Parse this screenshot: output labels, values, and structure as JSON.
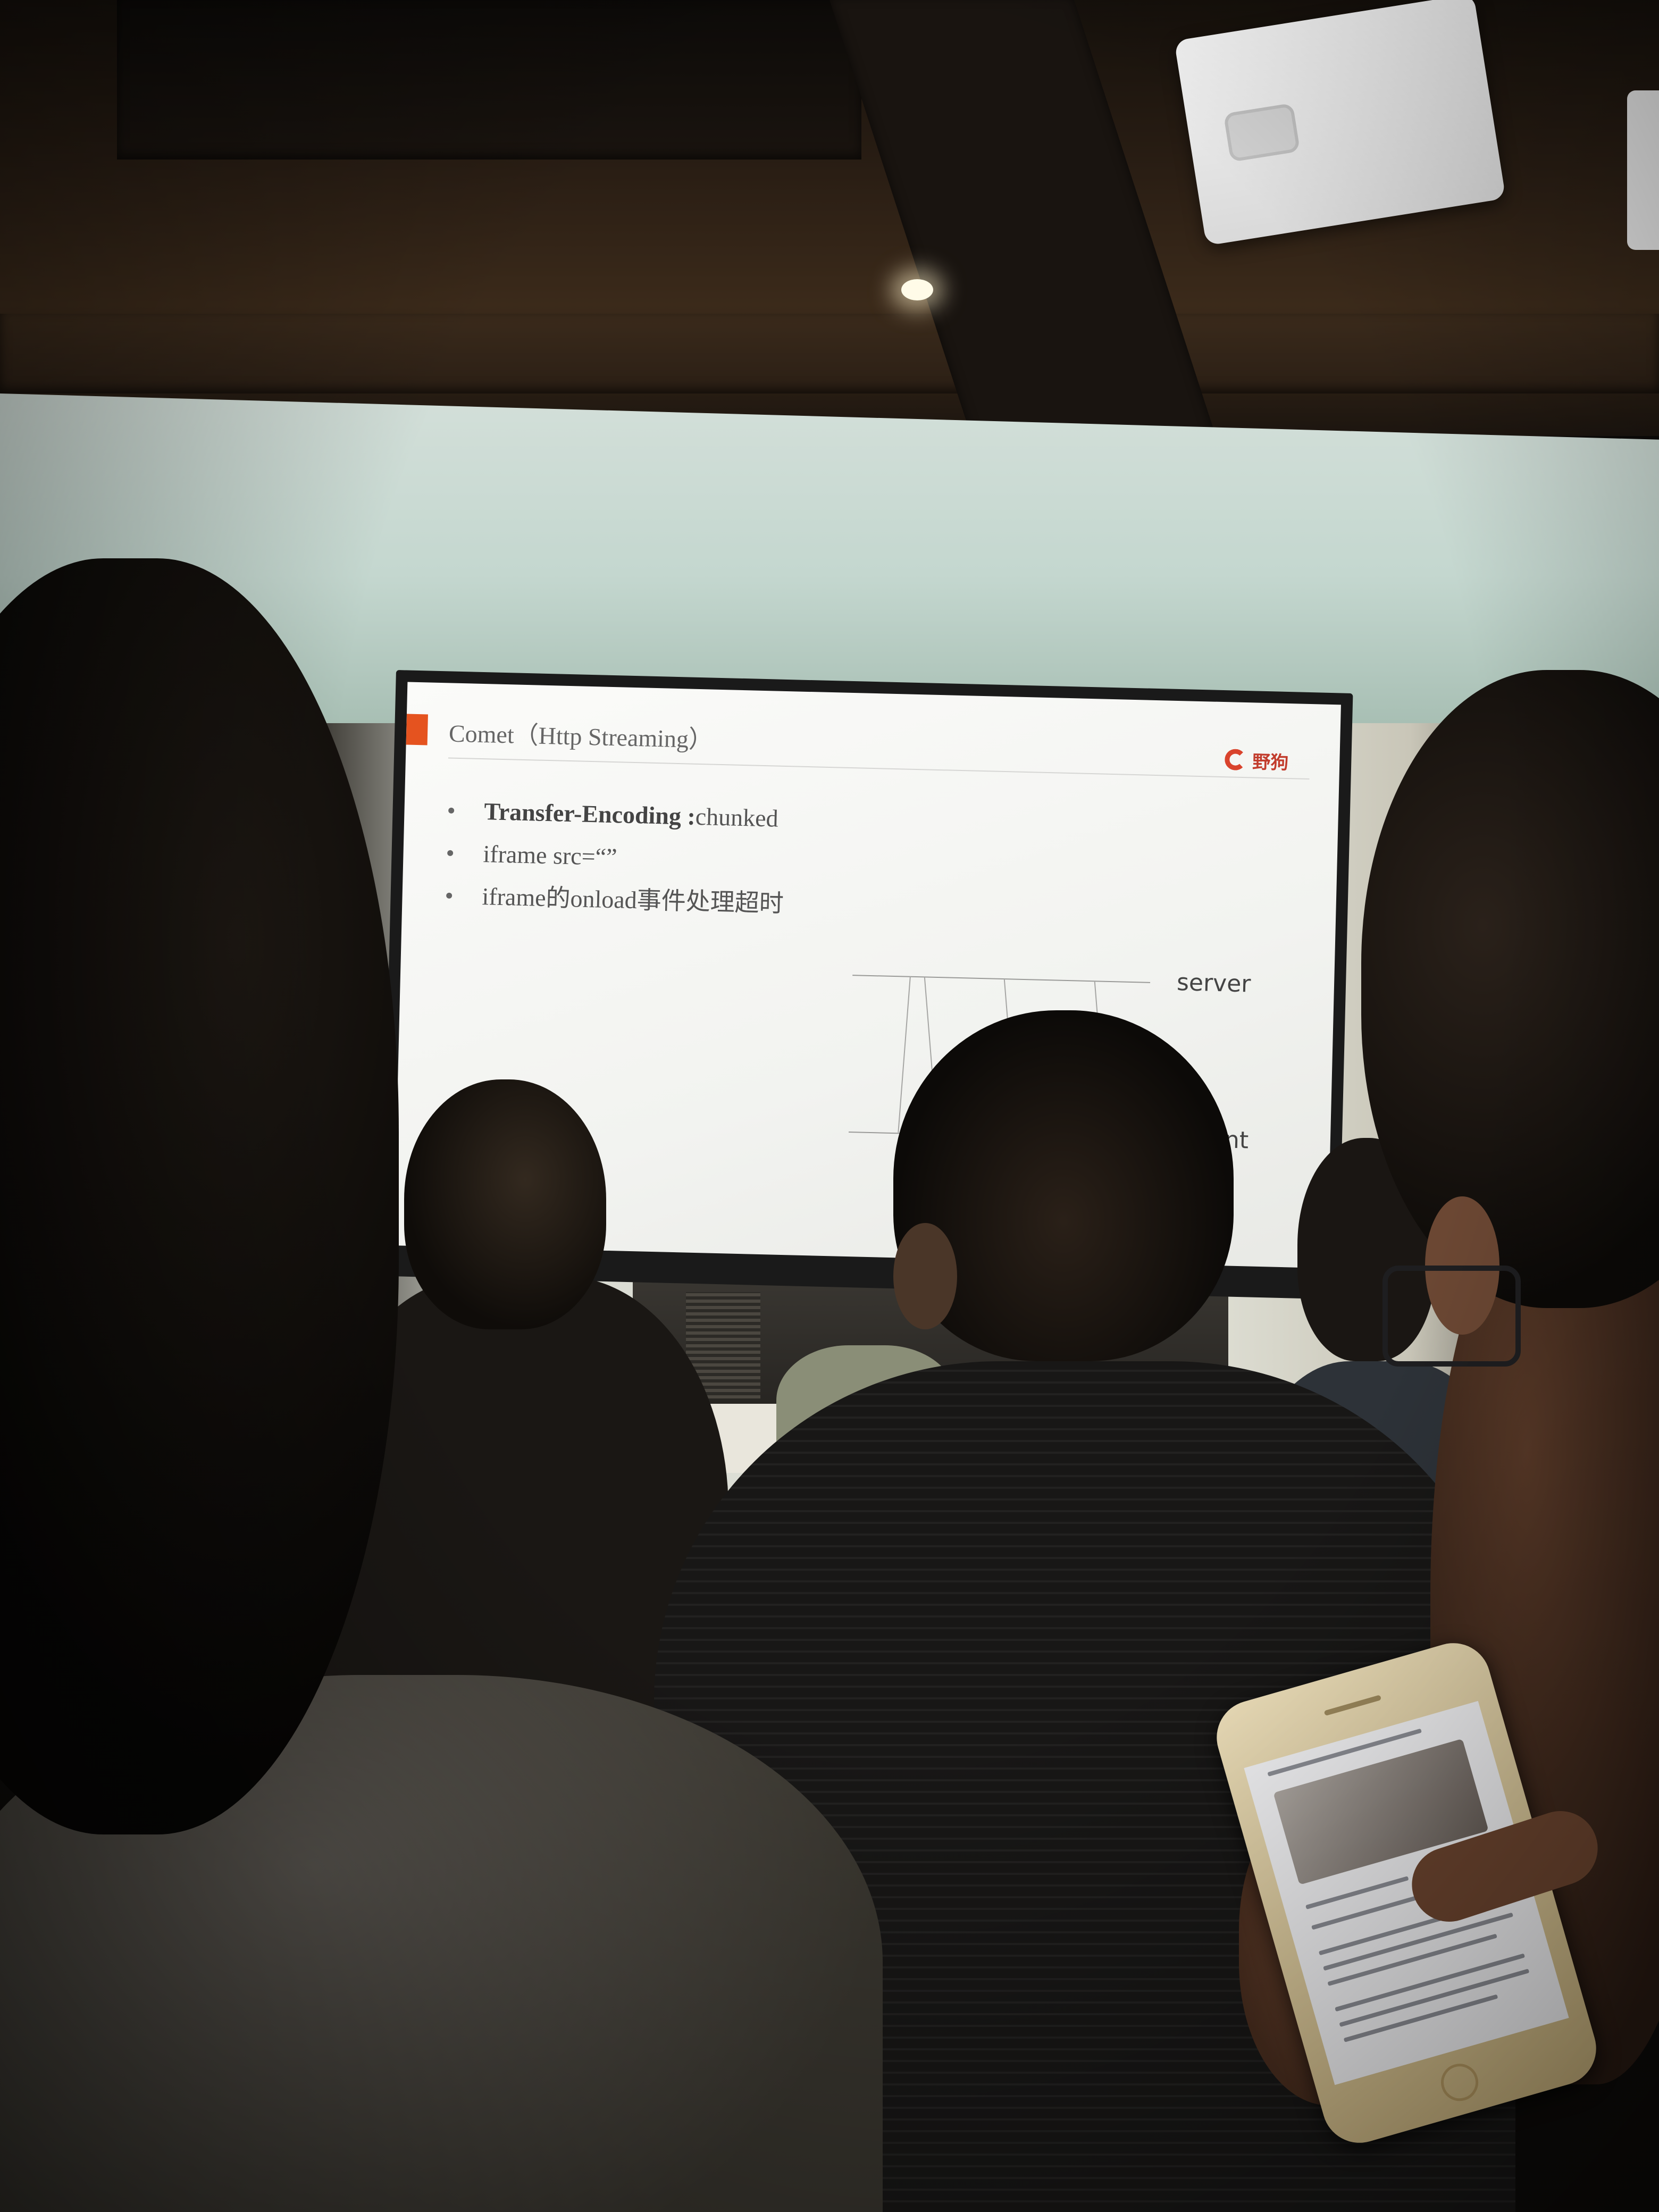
{
  "slide": {
    "title": "Comet（Http Streaming）",
    "logo_text": "野狗",
    "bullets": [
      {
        "bold": "Transfer-Encoding :",
        "text": "chunked"
      },
      {
        "bold": "",
        "text": "iframe src=“”"
      },
      {
        "bold": "",
        "text": "iframe的onload事件处理超时"
      }
    ],
    "diagram": {
      "top_label": "server",
      "bottom_label": "ent"
    }
  },
  "colors": {
    "slide_accent": "#e5531f",
    "logo_red": "#c23c2c",
    "screen_bg": "#f6f6f4"
  },
  "icons": {
    "logo": "wilddog-logo-icon"
  }
}
